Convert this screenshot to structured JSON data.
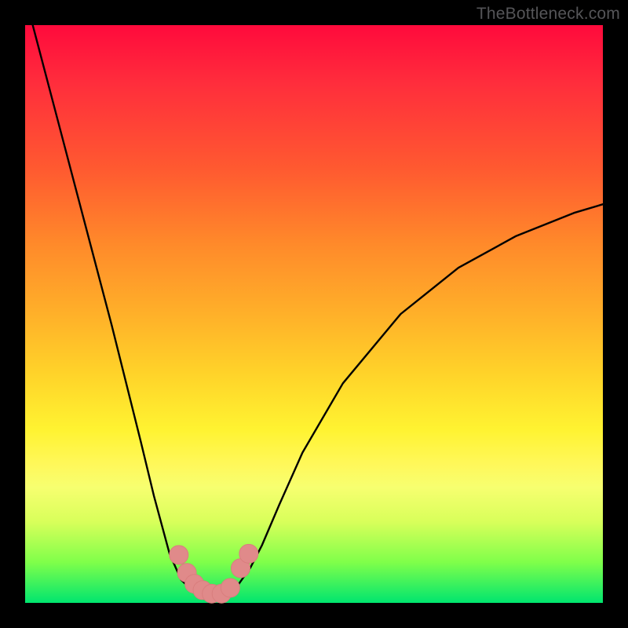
{
  "watermark": "TheBottleneck.com",
  "colors": {
    "frame": "#000000",
    "curve_stroke": "#000000",
    "marker_fill": "#e08a8a",
    "marker_stroke": "#d97e7e"
  },
  "chart_data": {
    "type": "line",
    "title": "",
    "xlabel": "",
    "ylabel": "",
    "x": [
      0,
      0.05,
      0.1,
      0.15,
      0.2,
      0.223,
      0.25,
      0.27,
      0.29,
      0.31,
      0.33,
      0.34,
      0.35,
      0.36,
      0.37,
      0.39,
      0.41,
      0.44,
      0.48,
      0.55,
      0.65,
      0.75,
      0.85,
      0.95,
      1.0
    ],
    "values": [
      1.05,
      0.86,
      0.67,
      0.48,
      0.28,
      0.185,
      0.085,
      0.04,
      0.021,
      0.013,
      0.013,
      0.015,
      0.018,
      0.024,
      0.033,
      0.061,
      0.1,
      0.17,
      0.26,
      0.38,
      0.5,
      0.58,
      0.635,
      0.675,
      0.69
    ],
    "xlim": [
      0,
      1
    ],
    "ylim": [
      0,
      1
    ],
    "markers": [
      {
        "x": 0.266,
        "y": 0.083,
        "r": 12
      },
      {
        "x": 0.28,
        "y": 0.052,
        "r": 12
      },
      {
        "x": 0.293,
        "y": 0.033,
        "r": 12
      },
      {
        "x": 0.307,
        "y": 0.022,
        "r": 12
      },
      {
        "x": 0.323,
        "y": 0.016,
        "r": 12
      },
      {
        "x": 0.34,
        "y": 0.016,
        "r": 12
      },
      {
        "x": 0.355,
        "y": 0.026,
        "r": 12
      },
      {
        "x": 0.373,
        "y": 0.06,
        "r": 12
      },
      {
        "x": 0.387,
        "y": 0.085,
        "r": 12
      }
    ],
    "gradient_stops": [
      {
        "offset": 0.0,
        "color": "#ff0a3c"
      },
      {
        "offset": 0.5,
        "color": "#ffb029"
      },
      {
        "offset": 0.75,
        "color": "#fff85a"
      },
      {
        "offset": 1.0,
        "color": "#00e56f"
      }
    ]
  }
}
